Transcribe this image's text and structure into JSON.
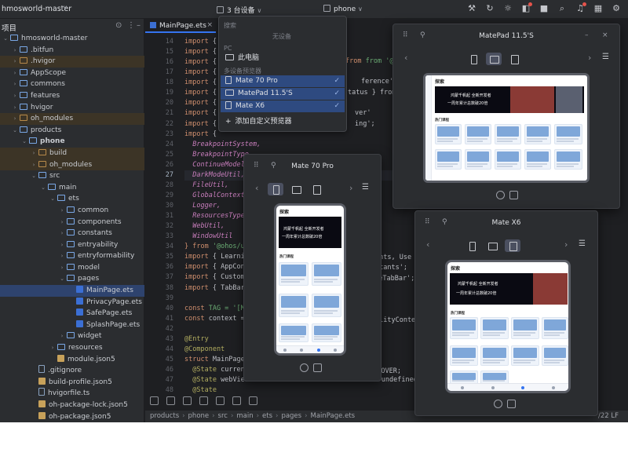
{
  "topbar": {
    "project_name": "hmosworld-master",
    "devices_label": "3 台设备",
    "target_label": "phone"
  },
  "project_panel": {
    "title": "项目",
    "tree": [
      {
        "label": "hmosworld-master",
        "depth": 0,
        "type": "folder",
        "open": true
      },
      {
        "label": ".bitfun",
        "depth": 1,
        "type": "folder"
      },
      {
        "label": ".hvigor",
        "depth": 1,
        "type": "folder-excluded",
        "hl": true
      },
      {
        "label": "AppScope",
        "depth": 1,
        "type": "folder"
      },
      {
        "label": "commons",
        "depth": 1,
        "type": "folder"
      },
      {
        "label": "features",
        "depth": 1,
        "type": "folder"
      },
      {
        "label": "hvigor",
        "depth": 1,
        "type": "folder"
      },
      {
        "label": "oh_modules",
        "depth": 1,
        "type": "folder-excluded",
        "hl": true
      },
      {
        "label": "products",
        "depth": 1,
        "type": "folder",
        "open": true
      },
      {
        "label": "phone",
        "depth": 2,
        "type": "folder",
        "open": true,
        "bold": true
      },
      {
        "label": "build",
        "depth": 3,
        "type": "folder-excluded",
        "hl": true
      },
      {
        "label": "oh_modules",
        "depth": 3,
        "type": "folder-excluded",
        "hl": true
      },
      {
        "label": "src",
        "depth": 3,
        "type": "folder",
        "open": true
      },
      {
        "label": "main",
        "depth": 4,
        "type": "folder",
        "open": true
      },
      {
        "label": "ets",
        "depth": 5,
        "type": "folder",
        "open": true
      },
      {
        "label": "common",
        "depth": 6,
        "type": "folder"
      },
      {
        "label": "components",
        "depth": 6,
        "type": "folder"
      },
      {
        "label": "constants",
        "depth": 6,
        "type": "folder"
      },
      {
        "label": "entryability",
        "depth": 6,
        "type": "folder"
      },
      {
        "label": "entryformability",
        "depth": 6,
        "type": "folder"
      },
      {
        "label": "model",
        "depth": 6,
        "type": "folder"
      },
      {
        "label": "pages",
        "depth": 6,
        "type": "folder",
        "open": true
      },
      {
        "label": "MainPage.ets",
        "depth": 7,
        "type": "ets",
        "sel": true
      },
      {
        "label": "PrivacyPage.ets",
        "depth": 7,
        "type": "ets"
      },
      {
        "label": "SafePage.ets",
        "depth": 7,
        "type": "ets"
      },
      {
        "label": "SplashPage.ets",
        "depth": 7,
        "type": "ets"
      },
      {
        "label": "widget",
        "depth": 6,
        "type": "folder"
      },
      {
        "label": "resources",
        "depth": 5,
        "type": "folder"
      },
      {
        "label": "module.json5",
        "depth": 5,
        "type": "json"
      },
      {
        "label": ".gitignore",
        "depth": 3,
        "type": "file"
      },
      {
        "label": "build-profile.json5",
        "depth": 3,
        "type": "json"
      },
      {
        "label": "hvigorfile.ts",
        "depth": 3,
        "type": "ts"
      },
      {
        "label": "oh-package-lock.json5",
        "depth": 3,
        "type": "json"
      },
      {
        "label": "oh-package.json5",
        "depth": 3,
        "type": "json"
      }
    ]
  },
  "editor": {
    "tab_label": "MainPage.ets",
    "line_numbers": [
      "14",
      "15",
      "16",
      "17",
      "18",
      "19",
      "20",
      "21",
      "22",
      "23",
      "24",
      "25",
      "26",
      "27",
      "28",
      "29",
      "30",
      "31",
      "32",
      "33",
      "34",
      "35",
      "36",
      "37",
      "38",
      "39",
      "40",
      "41",
      "42",
      "43",
      "44",
      "45",
      "46",
      "47",
      "48"
    ],
    "current_line": "27",
    "code_lines": [
      "import {",
      "import {",
      "import {",
      "import {",
      "import {",
      "import {",
      "import {",
      "import {",
      "import {",
      "import {",
      "  BreakpointSystem,",
      "  BreakpointType,",
      "  ContinueModel",
      "  DarkModeUtil,",
      "  FileUtil,",
      "  GlobalContext",
      "  Logger,",
      "  ResourcesType",
      "  WebUtil,",
      "  WindowUtil",
      "} from '@ohos/u",
      "import { Learni",
      "import { AppCon",
      "import { Custom",
      "import { TabBar",
      "",
      "const TAG = '[M",
      "const context =",
      "",
      "@Entry",
      "@Component",
      "struct MainPage",
      "  @State current",
      "  @State webViewController?: WebviewController = undefined",
      "  @State"
    ],
    "frag_import_from": "from '@kit.A",
    "frag_reference": "ference';",
    "frag_status": "tatus } from",
    "frag_ver": "ver'",
    "frag_ing": "ing';",
    "frag_contents": "ents, Use",
    "frag_stants": "stants';",
    "frag_tabbar": "omeTabBar';",
    "frag_ility": "ilityConte",
    "frag_iscover": "ISCOVER;"
  },
  "breadcrumb": [
    "products",
    "phone",
    "src",
    "main",
    "ets",
    "pages",
    "MainPage.ets"
  ],
  "status_position": "/22  LF",
  "device_dropdown": {
    "placeholder": "搜索",
    "no_device": "无设备",
    "section_pc": "PC",
    "this_pc": "此电脑",
    "section_preview": "多设备预览器",
    "devices": [
      "Mate 70 Pro",
      "MatePad 11.5'S",
      "Mate X6"
    ],
    "add_custom": "添加自定义预览器"
  },
  "previews": [
    {
      "title": "Mate 70 Pro"
    },
    {
      "title": "MatePad 11.5'S"
    },
    {
      "title": "Mate X6"
    }
  ],
  "app_screen": {
    "header": "探索",
    "banner_text": "鸿蒙千帆起 全新开发者",
    "banner_text_2": "一周年累计总数破20倍",
    "section": "热门课程"
  }
}
